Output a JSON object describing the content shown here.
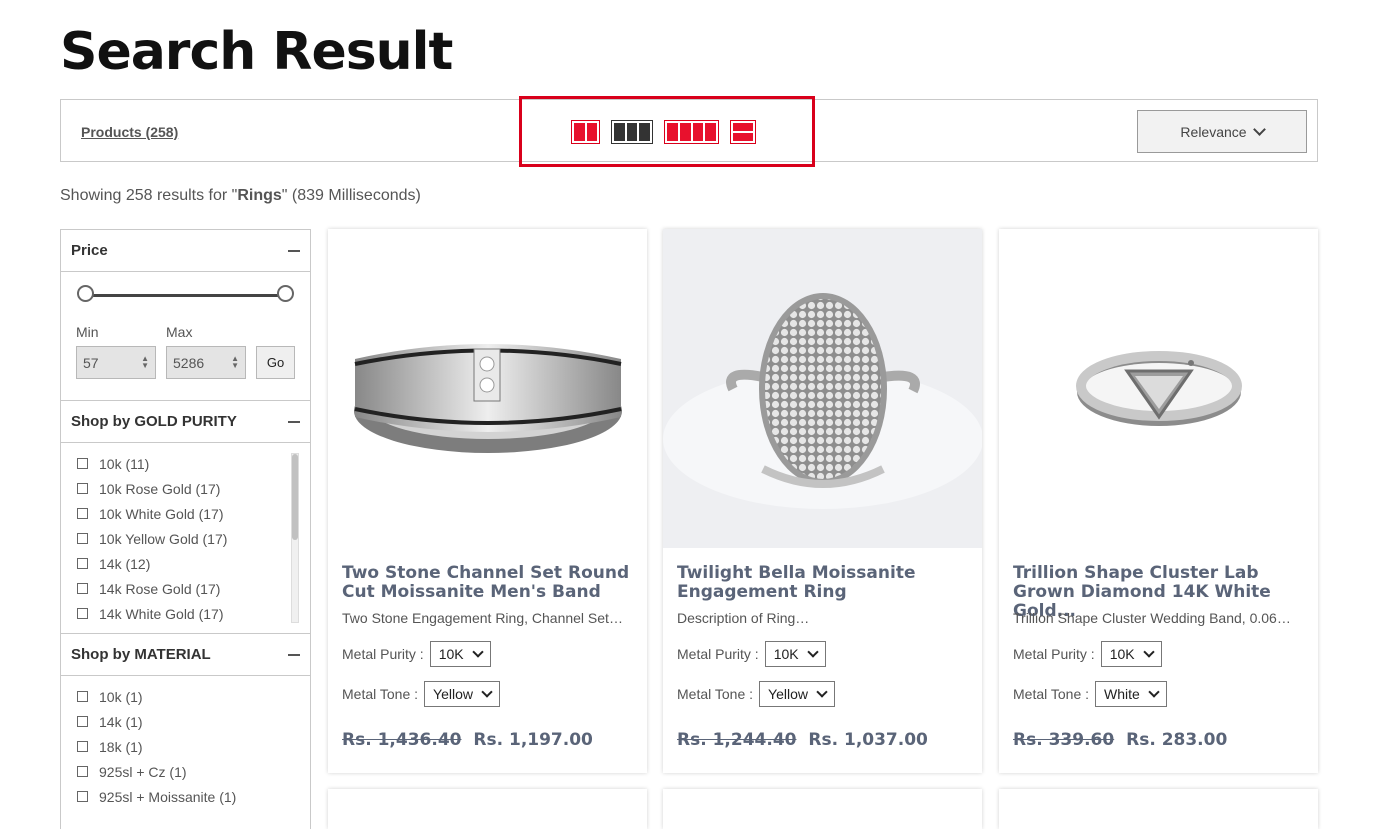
{
  "page": {
    "title": "Search Result"
  },
  "toolbar": {
    "products_label": "Products (258)",
    "sort_label": "Relevance"
  },
  "results": {
    "prefix": "Showing 258 results for \"",
    "query": "Rings",
    "suffix": "\" (839 Milliseconds)"
  },
  "filters": {
    "price": {
      "title": "Price",
      "min_label": "Min",
      "max_label": "Max",
      "min_value": "57",
      "max_value": "5286",
      "go_label": "Go"
    },
    "gold_purity": {
      "title": "Shop by GOLD PURITY",
      "items": [
        "10k (11)",
        "10k Rose Gold (17)",
        "10k White Gold (17)",
        "10k Yellow Gold (17)",
        "14k (12)",
        "14k Rose Gold (17)",
        "14k White Gold (17)"
      ]
    },
    "material": {
      "title": "Shop by MATERIAL",
      "items": [
        "10k (1)",
        "14k (1)",
        "18k (1)",
        "925sl + Cz (1)",
        "925sl + Moissanite (1)"
      ]
    }
  },
  "products": [
    {
      "title": "Two Stone Channel Set Round Cut Moissanite Men's Band",
      "desc": "Two Stone Engagement Ring, Channel Set…",
      "purity_label": "Metal Purity :",
      "purity": "10K",
      "tone_label": "Metal Tone :",
      "tone": "Yellow",
      "old_price": "Rs. 1,436.40",
      "price": "Rs. 1,197.00"
    },
    {
      "title": "Twilight Bella Moissanite Engagement Ring",
      "desc": "Description of Ring…",
      "purity_label": "Metal Purity :",
      "purity": "10K",
      "tone_label": "Metal Tone :",
      "tone": "Yellow",
      "old_price": "Rs. 1,244.40",
      "price": "Rs. 1,037.00"
    },
    {
      "title": "Trillion Shape Cluster Lab Grown Diamond 14K White Gold...",
      "desc": "Trillion Shape Cluster Wedding Band, 0.06…",
      "purity_label": "Metal Purity :",
      "purity": "10K",
      "tone_label": "Metal Tone :",
      "tone": "White",
      "old_price": "Rs. 339.60",
      "price": "Rs. 283.00"
    }
  ],
  "colors": {
    "accent": "#d9001b",
    "title_text": "#5a6478"
  }
}
